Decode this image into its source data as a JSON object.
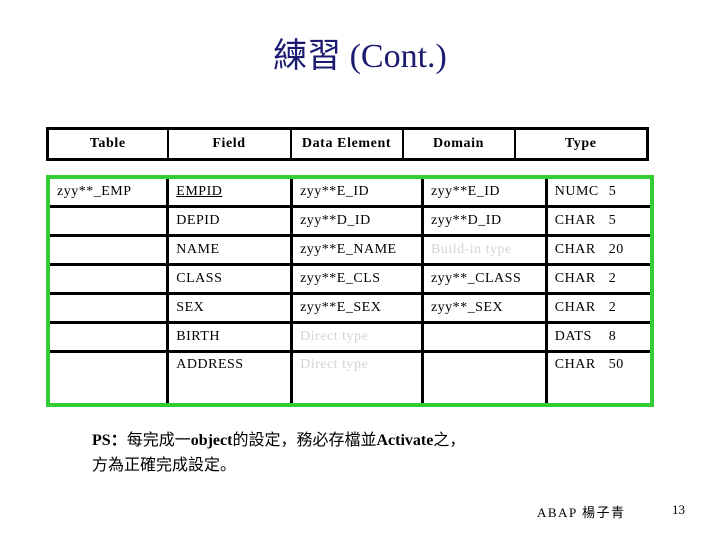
{
  "slide": {
    "title": "練習 (Cont.)",
    "title_color": "#1b1b72",
    "accent_color": "#33cc33",
    "muted_color": "#d4d4d4"
  },
  "table": {
    "headers": [
      "Table",
      "Field",
      "Data Element",
      "Domain",
      "Type"
    ],
    "rows": [
      {
        "table": "zyy**_EMP",
        "field": "EMPID",
        "field_is_key": true,
        "data_element": "zyy**E_ID",
        "data_element_muted": false,
        "domain": "zyy**E_ID",
        "domain_muted": false,
        "type_name": "NUMC",
        "type_length": "5"
      },
      {
        "table": "",
        "field": "DEPID",
        "field_is_key": false,
        "data_element": "zyy**D_ID",
        "data_element_muted": false,
        "domain": "zyy**D_ID",
        "domain_muted": false,
        "type_name": "CHAR",
        "type_length": "5"
      },
      {
        "table": "",
        "field": "NAME",
        "field_is_key": false,
        "data_element": "zyy**E_NAME",
        "data_element_muted": false,
        "domain": "Build-in type",
        "domain_muted": true,
        "type_name": "CHAR",
        "type_length": "20"
      },
      {
        "table": "",
        "field": "CLASS",
        "field_is_key": false,
        "data_element": "zyy**E_CLS",
        "data_element_muted": false,
        "domain": "zyy**_CLASS",
        "domain_muted": false,
        "type_name": "CHAR",
        "type_length": "2"
      },
      {
        "table": "",
        "field": "SEX",
        "field_is_key": false,
        "data_element": "zyy**E_SEX",
        "data_element_muted": false,
        "domain": "zyy**_SEX",
        "domain_muted": false,
        "type_name": "CHAR",
        "type_length": "2"
      },
      {
        "table": "",
        "field": "BIRTH",
        "field_is_key": false,
        "data_element": "Direct type",
        "data_element_muted": true,
        "domain": "",
        "domain_muted": false,
        "type_name": "DATS",
        "type_length": "8"
      },
      {
        "table": "",
        "field": "ADDRESS",
        "field_is_key": false,
        "data_element": "Direct type",
        "data_element_muted": true,
        "domain": "",
        "domain_muted": false,
        "type_name": "CHAR",
        "type_length": "50"
      }
    ]
  },
  "note": {
    "label": "PS：",
    "line1_a": "每完成一",
    "line1_b": "object",
    "line1_c": "的設定，務必存檔並",
    "line1_d": "Activate",
    "line1_e": "之，",
    "line2": "方為正確完成設定。"
  },
  "footer": {
    "author": "ABAP 楊子青",
    "page": "13"
  }
}
